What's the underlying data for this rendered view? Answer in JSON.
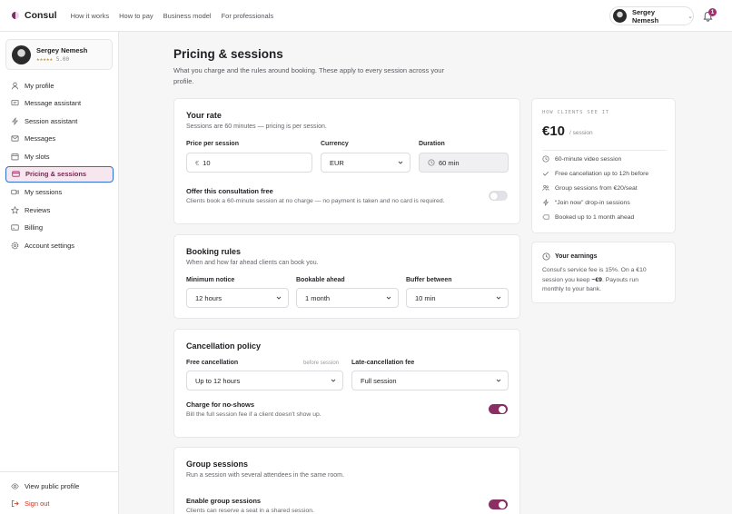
{
  "app": {
    "brand": "Consul"
  },
  "nav": [
    "How it works",
    "How to pay",
    "Business model",
    "For professionals"
  ],
  "user": {
    "name": "Sergey Nemesh",
    "rating_stars": "★★★★★",
    "rating_value": "5.00",
    "notifications": "1"
  },
  "sidebar": {
    "items": [
      {
        "label": "My profile",
        "icon": "user-icon"
      },
      {
        "label": "Message assistant",
        "icon": "message-icon"
      },
      {
        "label": "Session assistant",
        "icon": "bolt-icon"
      },
      {
        "label": "Messages",
        "icon": "mail-icon"
      },
      {
        "label": "My slots",
        "icon": "calendar-icon"
      },
      {
        "label": "Pricing & sessions",
        "icon": "card-icon",
        "active": true
      },
      {
        "label": "My sessions",
        "icon": "video-icon"
      },
      {
        "label": "Reviews",
        "icon": "star-icon"
      },
      {
        "label": "Billing",
        "icon": "billing-icon"
      },
      {
        "label": "Account settings",
        "icon": "gear-icon"
      }
    ],
    "bottom": [
      {
        "label": "View public profile",
        "icon": "eye-icon"
      },
      {
        "label": "Sign out",
        "icon": "sign-out-icon"
      }
    ]
  },
  "page": {
    "title": "Pricing & sessions",
    "description": "What you charge and the rules around booking. These apply to every session across your profile."
  },
  "rate": {
    "title": "Your rate",
    "subtitle": "Sessions are 60 minutes — pricing is per session.",
    "price_label": "Price per session",
    "price_prefix": "€",
    "price_value": "10",
    "currency_label": "Currency",
    "currency_value": "EUR",
    "duration_label": "Duration",
    "duration_value": "60 min",
    "free_title": "Offer this consultation free",
    "free_desc": "Clients book a 60-minute session at no charge — no payment is taken and no card is required."
  },
  "booking": {
    "title": "Booking rules",
    "subtitle": "When and how far ahead clients can book you.",
    "notice_label": "Minimum notice",
    "notice_value": "12 hours",
    "ahead_label": "Bookable ahead",
    "ahead_value": "1 month",
    "buffer_label": "Buffer between",
    "buffer_value": "10 min"
  },
  "cancellation": {
    "title": "Cancellation policy",
    "free_label": "Free cancellation",
    "free_note": "before session",
    "free_value": "Up to 12 hours",
    "late_label": "Late-cancellation fee",
    "late_value": "Full session",
    "noshow_title": "Charge for no-shows",
    "noshow_desc": "Bill the full session fee if a client doesn't show up."
  },
  "group": {
    "title": "Group sessions",
    "subtitle": "Run a session with several attendees in the same room.",
    "enable_title": "Enable group sessions",
    "enable_desc": "Clients can reserve a seat in a shared session."
  },
  "preview": {
    "heading": "HOW CLIENTS SEE IT",
    "price": "€10",
    "unit": "/ session",
    "features": [
      {
        "text": "60-minute video session",
        "icon": "clock-icon"
      },
      {
        "text": "Free cancellation up to 12h before",
        "icon": "check-icon"
      },
      {
        "text": "Group sessions from €20/seat",
        "icon": "group-icon"
      },
      {
        "text": "“Join now” drop-in sessions",
        "icon": "bolt-icon"
      },
      {
        "text": "Booked up to 1 month ahead",
        "icon": "tag-icon"
      }
    ]
  },
  "earnings": {
    "title": "Your earnings",
    "text_a": "Consul's service fee is 15%. On a €10 session you keep ",
    "text_b": "~€9",
    "text_c": ". Payouts run monthly to your bank."
  },
  "colors": {
    "accent": "#8a2f63",
    "active_border": "#2f6fd6",
    "danger": "#c0392b"
  }
}
